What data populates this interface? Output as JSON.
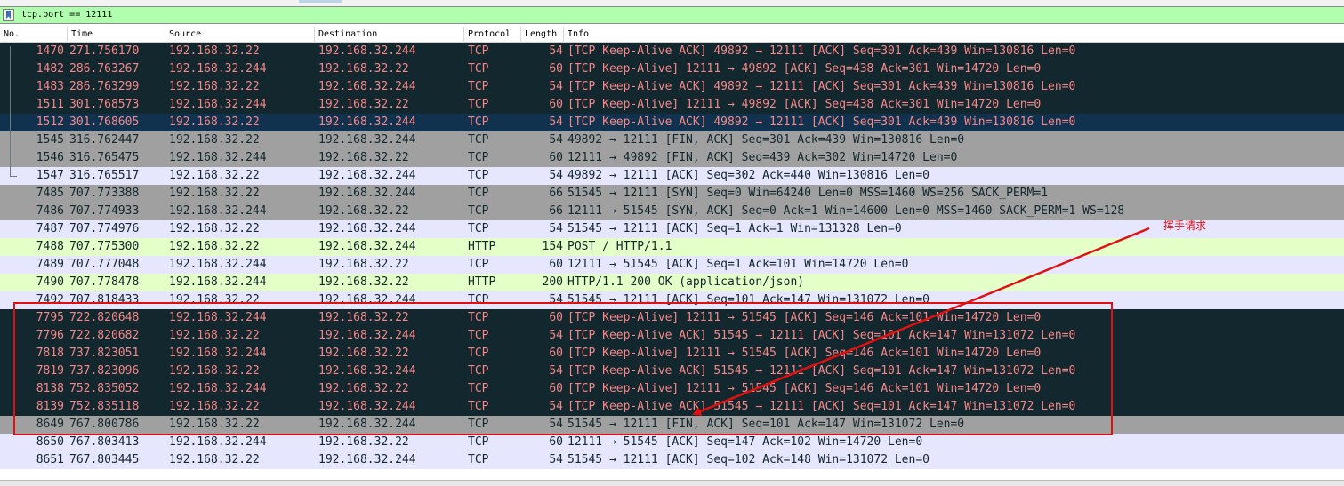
{
  "filter": {
    "value": "tcp.port == 12111"
  },
  "columns": {
    "no": "No.",
    "time": "Time",
    "source": "Source",
    "destination": "Destination",
    "protocol": "Protocol",
    "length": "Length",
    "info": "Info"
  },
  "packets": [
    {
      "no": "1470",
      "time": "271.756170",
      "src": "192.168.32.22",
      "dst": "192.168.32.244",
      "proto": "TCP",
      "len": "54",
      "info": "[TCP Keep-Alive ACK] 49892 → 12111 [ACK] Seq=301 Ack=439 Win=130816 Len=0",
      "style": "dark"
    },
    {
      "no": "1482",
      "time": "286.763267",
      "src": "192.168.32.244",
      "dst": "192.168.32.22",
      "proto": "TCP",
      "len": "60",
      "info": "[TCP Keep-Alive] 12111 → 49892 [ACK] Seq=438 Ack=301 Win=14720 Len=0",
      "style": "dark"
    },
    {
      "no": "1483",
      "time": "286.763299",
      "src": "192.168.32.22",
      "dst": "192.168.32.244",
      "proto": "TCP",
      "len": "54",
      "info": "[TCP Keep-Alive ACK] 49892 → 12111 [ACK] Seq=301 Ack=439 Win=130816 Len=0",
      "style": "dark"
    },
    {
      "no": "1511",
      "time": "301.768573",
      "src": "192.168.32.244",
      "dst": "192.168.32.22",
      "proto": "TCP",
      "len": "60",
      "info": "[TCP Keep-Alive] 12111 → 49892 [ACK] Seq=438 Ack=301 Win=14720 Len=0",
      "style": "dark"
    },
    {
      "no": "1512",
      "time": "301.768605",
      "src": "192.168.32.22",
      "dst": "192.168.32.244",
      "proto": "TCP",
      "len": "54",
      "info": "[TCP Keep-Alive ACK] 49892 → 12111 [ACK] Seq=301 Ack=439 Win=130816 Len=0",
      "style": "sel"
    },
    {
      "no": "1545",
      "time": "316.762447",
      "src": "192.168.32.22",
      "dst": "192.168.32.244",
      "proto": "TCP",
      "len": "54",
      "info": "49892 → 12111 [FIN, ACK] Seq=301 Ack=439 Win=130816 Len=0",
      "style": "gray"
    },
    {
      "no": "1546",
      "time": "316.765475",
      "src": "192.168.32.244",
      "dst": "192.168.32.22",
      "proto": "TCP",
      "len": "60",
      "info": "12111 → 49892 [FIN, ACK] Seq=439 Ack=302 Win=14720 Len=0",
      "style": "gray"
    },
    {
      "no": "1547",
      "time": "316.765517",
      "src": "192.168.32.22",
      "dst": "192.168.32.244",
      "proto": "TCP",
      "len": "54",
      "info": "49892 → 12111 [ACK] Seq=302 Ack=440 Win=130816 Len=0",
      "style": "lav"
    },
    {
      "no": "7485",
      "time": "707.773388",
      "src": "192.168.32.22",
      "dst": "192.168.32.244",
      "proto": "TCP",
      "len": "66",
      "info": "51545 → 12111 [SYN] Seq=0 Win=64240 Len=0 MSS=1460 WS=256 SACK_PERM=1",
      "style": "gray"
    },
    {
      "no": "7486",
      "time": "707.774933",
      "src": "192.168.32.244",
      "dst": "192.168.32.22",
      "proto": "TCP",
      "len": "66",
      "info": "12111 → 51545 [SYN, ACK] Seq=0 Ack=1 Win=14600 Len=0 MSS=1460 SACK_PERM=1 WS=128",
      "style": "gray"
    },
    {
      "no": "7487",
      "time": "707.774976",
      "src": "192.168.32.22",
      "dst": "192.168.32.244",
      "proto": "TCP",
      "len": "54",
      "info": "51545 → 12111 [ACK] Seq=1 Ack=1 Win=131328 Len=0",
      "style": "lav"
    },
    {
      "no": "7488",
      "time": "707.775300",
      "src": "192.168.32.22",
      "dst": "192.168.32.244",
      "proto": "HTTP",
      "len": "154",
      "info": "POST / HTTP/1.1",
      "style": "green"
    },
    {
      "no": "7489",
      "time": "707.777048",
      "src": "192.168.32.244",
      "dst": "192.168.32.22",
      "proto": "TCP",
      "len": "60",
      "info": "12111 → 51545 [ACK] Seq=1 Ack=101 Win=14720 Len=0",
      "style": "lav"
    },
    {
      "no": "7490",
      "time": "707.778478",
      "src": "192.168.32.244",
      "dst": "192.168.32.22",
      "proto": "HTTP",
      "len": "200",
      "info": "HTTP/1.1 200 OK  (application/json)",
      "style": "green"
    },
    {
      "no": "7492",
      "time": "707.818433",
      "src": "192.168.32.22",
      "dst": "192.168.32.244",
      "proto": "TCP",
      "len": "54",
      "info": "51545 → 12111 [ACK] Seq=101 Ack=147 Win=131072 Len=0",
      "style": "lav"
    },
    {
      "no": "7795",
      "time": "722.820648",
      "src": "192.168.32.244",
      "dst": "192.168.32.22",
      "proto": "TCP",
      "len": "60",
      "info": "[TCP Keep-Alive] 12111 → 51545 [ACK] Seq=146 Ack=101 Win=14720 Len=0",
      "style": "dark"
    },
    {
      "no": "7796",
      "time": "722.820682",
      "src": "192.168.32.22",
      "dst": "192.168.32.244",
      "proto": "TCP",
      "len": "54",
      "info": "[TCP Keep-Alive ACK] 51545 → 12111 [ACK] Seq=101 Ack=147 Win=131072 Len=0",
      "style": "dark"
    },
    {
      "no": "7818",
      "time": "737.823051",
      "src": "192.168.32.244",
      "dst": "192.168.32.22",
      "proto": "TCP",
      "len": "60",
      "info": "[TCP Keep-Alive] 12111 → 51545 [ACK] Seq=146 Ack=101 Win=14720 Len=0",
      "style": "dark"
    },
    {
      "no": "7819",
      "time": "737.823096",
      "src": "192.168.32.22",
      "dst": "192.168.32.244",
      "proto": "TCP",
      "len": "54",
      "info": "[TCP Keep-Alive ACK] 51545 → 12111 [ACK] Seq=101 Ack=147 Win=131072 Len=0",
      "style": "dark"
    },
    {
      "no": "8138",
      "time": "752.835052",
      "src": "192.168.32.244",
      "dst": "192.168.32.22",
      "proto": "TCP",
      "len": "60",
      "info": "[TCP Keep-Alive] 12111 → 51545 [ACK] Seq=146 Ack=101 Win=14720 Len=0",
      "style": "dark"
    },
    {
      "no": "8139",
      "time": "752.835118",
      "src": "192.168.32.22",
      "dst": "192.168.32.244",
      "proto": "TCP",
      "len": "54",
      "info": "[TCP Keep-Alive ACK] 51545 → 12111 [ACK] Seq=101 Ack=147 Win=131072 Len=0",
      "style": "dark"
    },
    {
      "no": "8649",
      "time": "767.800786",
      "src": "192.168.32.22",
      "dst": "192.168.32.244",
      "proto": "TCP",
      "len": "54",
      "info": "51545 → 12111 [FIN, ACK] Seq=101 Ack=147 Win=131072 Len=0",
      "style": "gray"
    },
    {
      "no": "8650",
      "time": "767.803413",
      "src": "192.168.32.244",
      "dst": "192.168.32.22",
      "proto": "TCP",
      "len": "60",
      "info": "12111 → 51545 [ACK] Seq=147 Ack=102 Win=14720 Len=0",
      "style": "lav"
    },
    {
      "no": "8651",
      "time": "767.803445",
      "src": "192.168.32.22",
      "dst": "192.168.32.244",
      "proto": "TCP",
      "len": "54",
      "info": "51545 → 12111 [ACK] Seq=102 Ack=148 Win=131072 Len=0",
      "style": "lav"
    }
  ],
  "annotation": {
    "label": "挥手请求",
    "color": "#e01010"
  },
  "colors": {
    "filter_bg": "#afffaf",
    "row_dark": "#12272e",
    "row_selected": "#10324e",
    "row_gray": "#a0a0a0",
    "row_lavender": "#e7e6ff",
    "row_green": "#e4ffc7",
    "text_keepalive": "#f78787"
  }
}
